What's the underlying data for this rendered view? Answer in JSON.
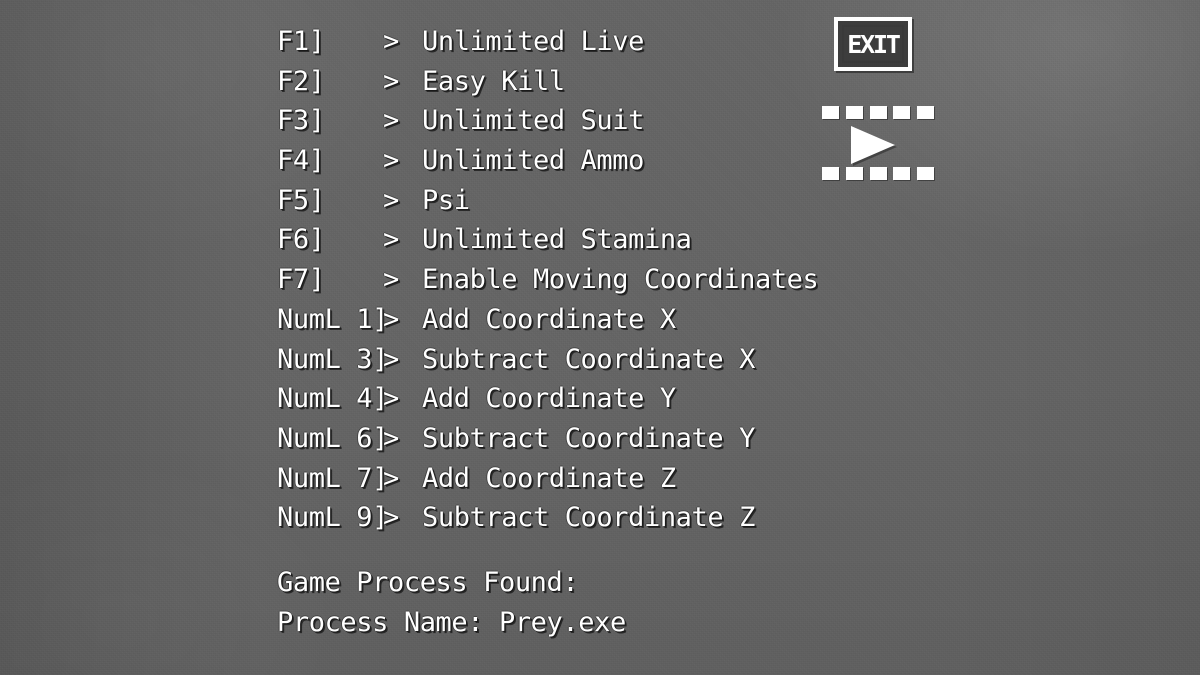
{
  "window": {
    "background_color": "#656565",
    "text_color": "#ffffff"
  },
  "cheat_menu": {
    "arrow_glyph": ">",
    "rows": [
      {
        "hotkey": "F1]",
        "arrow": ">",
        "label": "Unlimited Live"
      },
      {
        "hotkey": "F2]",
        "arrow": ">",
        "label": "Easy Kill"
      },
      {
        "hotkey": "F3]",
        "arrow": ">",
        "label": "Unlimited Suit"
      },
      {
        "hotkey": "F4]",
        "arrow": ">",
        "label": "Unlimited Ammo"
      },
      {
        "hotkey": "F5]",
        "arrow": ">",
        "label": "Psi"
      },
      {
        "hotkey": "F6]",
        "arrow": ">",
        "label": "Unlimited Stamina"
      },
      {
        "hotkey": "F7]",
        "arrow": ">",
        "label": "Enable Moving Coordinates"
      },
      {
        "hotkey": "NumL 1]",
        "arrow": ">",
        "label": "Add Coordinate X"
      },
      {
        "hotkey": "NumL 3]",
        "arrow": ">",
        "label": "Subtract Coordinate X"
      },
      {
        "hotkey": "NumL 4]",
        "arrow": ">",
        "label": "Add Coordinate Y"
      },
      {
        "hotkey": "NumL 6]",
        "arrow": ">",
        "label": "Subtract Coordinate Y"
      },
      {
        "hotkey": "NumL 7]",
        "arrow": ">",
        "label": "Add Coordinate Z"
      },
      {
        "hotkey": "NumL 9]",
        "arrow": ">",
        "label": "Subtract Coordinate Z"
      }
    ]
  },
  "status": {
    "process_found": "Game Process Found:",
    "process_name": "Process Name: Prey.exe"
  },
  "exit_button": {
    "label": "EXIT",
    "icon": "exit-sign-icon"
  },
  "play_icon": {
    "icon": "film-strip-play-icon",
    "perforation_count": 5
  }
}
